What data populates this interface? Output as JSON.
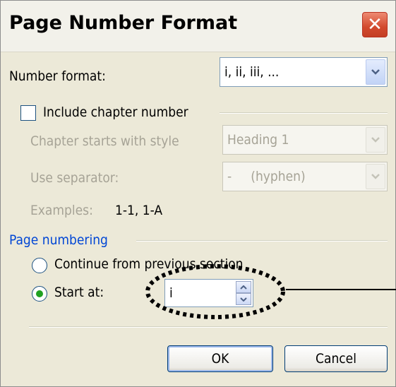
{
  "window": {
    "title": "Page Number Format"
  },
  "number_format": {
    "label": "Number format:",
    "value": "i, ii, iii, ..."
  },
  "include_chapter": {
    "label": "Include chapter number",
    "checked": false
  },
  "chapter_style": {
    "label": "Chapter starts with style",
    "value": "Heading 1"
  },
  "separator": {
    "label": "Use separator:",
    "value": "-     (hyphen)"
  },
  "examples": {
    "label": "Examples:",
    "value": "1-1, 1-A"
  },
  "page_numbering": {
    "heading": "Page numbering",
    "continue_label": "Continue from previous section",
    "start_label": "Start at:",
    "start_value": "i",
    "selected": "start_at"
  },
  "buttons": {
    "ok": "OK",
    "cancel": "Cancel"
  }
}
